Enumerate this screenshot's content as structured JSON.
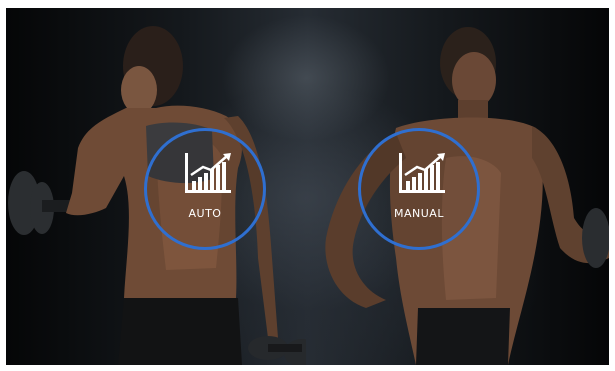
{
  "modes": [
    {
      "id": "auto",
      "label": "AUTO",
      "icon": "bar-chart-trend-icon"
    },
    {
      "id": "manual",
      "label": "MANUAL",
      "icon": "bar-chart-trend-icon"
    }
  ],
  "colors": {
    "ring": "#2f6fd0",
    "background": "#1c2126",
    "label": "#ffffff"
  }
}
